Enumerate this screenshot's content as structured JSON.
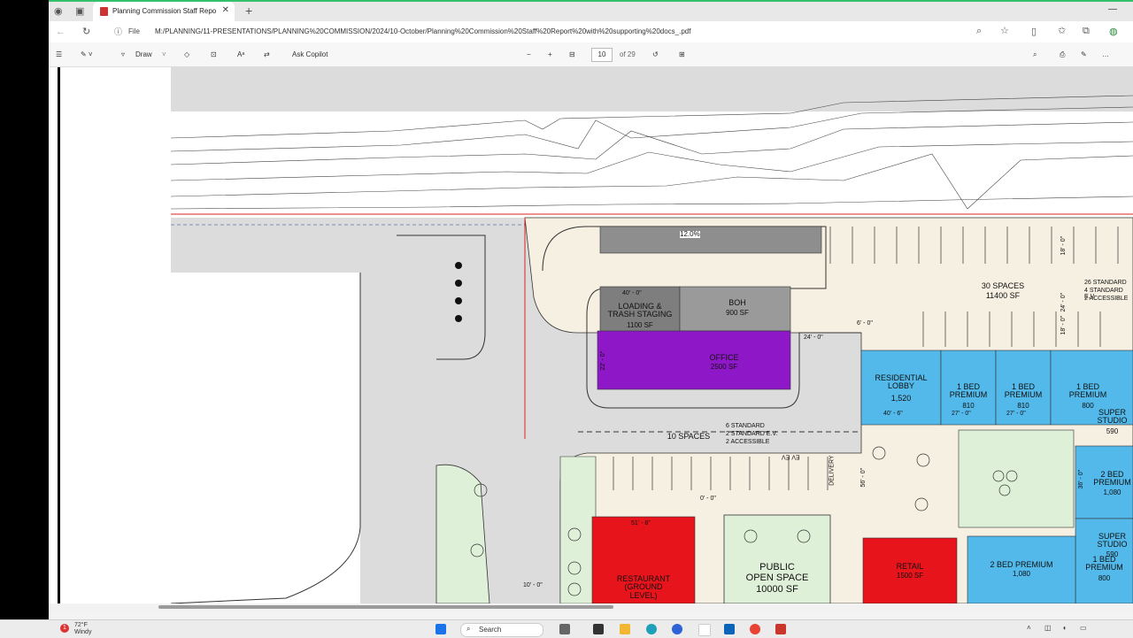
{
  "browser": {
    "tab_title": "Planning Commission Staff Repo",
    "file_label": "File",
    "url": "M:/PLANNING/11-PRESENTATIONS/PLANNING%20COMMISSION/2024/10-October/Planning%20Commission%20Staff%20Report%20with%20supporting%20docs_.pdf"
  },
  "pdf_toolbar": {
    "draw_label": "Draw",
    "copilot_label": "Ask Copilot",
    "current_page": "10",
    "page_total": "of 29"
  },
  "plan": {
    "slope": "12.0%",
    "loading": {
      "dim": "40' - 0\"",
      "name": "LOADING &\nTRASH STAGING",
      "area": "1100 SF"
    },
    "boh": {
      "name": "BOH",
      "area": "900 SF"
    },
    "office": {
      "name": "OFFICE",
      "area": "2500 SF",
      "dim": "22' - 0\""
    },
    "dim_24": "24' - 0\"",
    "dim_6": "6' - 0\"",
    "dim_0": "0' - 0\"",
    "dim_27a": "27' - 0\"",
    "dim_27b": "27' - 0\"",
    "dim_40": "40' - 6\"",
    "dim_56": "56' - 0\"",
    "dim_36": "36' - 0\"",
    "dim_51": "51' - 8\"",
    "dim_10": "10' - 0\"",
    "dim_18a": "18' - 0\"",
    "dim_24b": "24' - 0\"",
    "dim_18b": "18' - 0\"",
    "parking_30": {
      "spaces": "30 SPACES",
      "area": "11400 SF"
    },
    "parking_26": {
      "line1": "26 STANDARD",
      "line2": "4 STANDARD E.V.",
      "line3": "2 ACCESSIBLE"
    },
    "parking_10": {
      "spaces": "10 SPACES",
      "line1": "6 STANDARD",
      "line2": "2 STANDARD E.V.",
      "line3": "2 ACCESSIBLE",
      "ev": "EV  EV",
      "delivery": "DELIVERY"
    },
    "residential_lobby": {
      "name": "RESIDENTIAL\nLOBBY",
      "area": "1,520"
    },
    "unit_a": {
      "name": "1 BED\nPREMIUM",
      "area": "810"
    },
    "unit_b": {
      "name": "1 BED\nPREMIUM",
      "area": "810"
    },
    "unit_c": {
      "name": "1 BED\nPREMIUM",
      "area": "800"
    },
    "unit_d": {
      "name": "SUPER\nSTUDIO",
      "area": "590"
    },
    "unit_e": {
      "name": "2 BED\nPREMIUM",
      "area": "1,080"
    },
    "unit_f": {
      "name": "SUPER\nSTUDIO",
      "area": "590"
    },
    "unit_g": {
      "name": "2 BED PREMIUM",
      "area": "1,080"
    },
    "unit_h": {
      "name": "1 BED\nPREMIUM",
      "area": "800"
    },
    "restaurant": {
      "name": "RESTAURANT\n(GROUND\nLEVEL)"
    },
    "public_space": {
      "name": "PUBLIC\nOPEN SPACE",
      "area": "10000 SF"
    },
    "retail": {
      "name": "RETAIL",
      "area": "1500 SF"
    }
  },
  "taskbar": {
    "temp": "72°F",
    "cond": "Windy",
    "search_label": "Search",
    "badge": "1"
  },
  "colors": {
    "office": "#8e17c8",
    "residential": "#52b9ea",
    "red": "#e8141c",
    "loading_gray": "#7e7e7e",
    "boh_gray": "#9a9a9a",
    "paving": "#f5f0e2",
    "landscape": "#dff0d8"
  }
}
